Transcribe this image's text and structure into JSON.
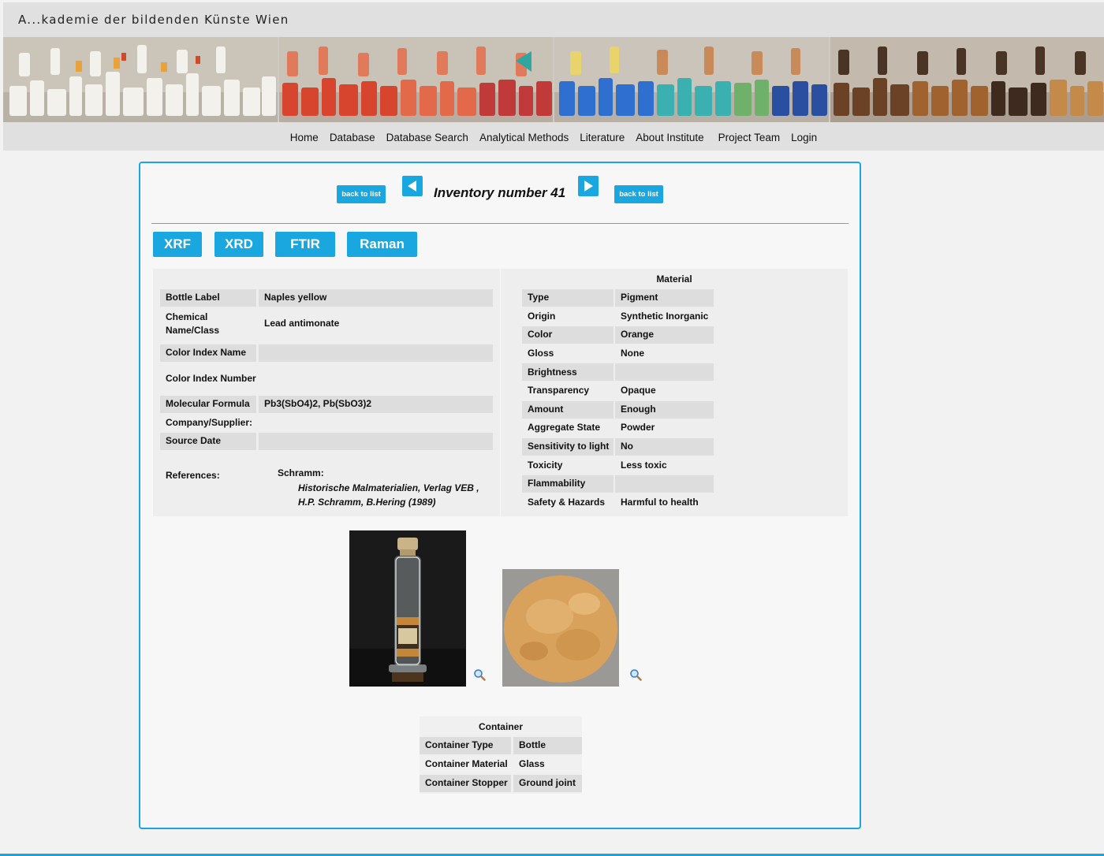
{
  "header": {
    "site_title": "A...kademie der bildenden Künste Wien"
  },
  "nav": {
    "items": [
      "Home",
      "Database",
      "Database Search",
      "Analytical Methods",
      "Literature",
      "About Institute",
      "Project Team",
      "Login"
    ]
  },
  "record": {
    "back_label_left": "back to list",
    "back_label_right": "back to list",
    "title": "Inventory number 41",
    "prev_icon": "triangle-left-icon",
    "next_icon": "triangle-right-icon"
  },
  "tabs": [
    "XRF",
    "XRD",
    "FTIR",
    "Raman"
  ],
  "general": {
    "rows": [
      {
        "label": "Bottle Label",
        "value": "Naples yellow"
      },
      {
        "label": "Chemical Name/Class",
        "value": "Lead antimonate"
      },
      {
        "label": "Color Index Name",
        "value": ""
      },
      {
        "label": "Color Index Number",
        "value": ""
      },
      {
        "label": "Molecular Formula",
        "value": "Pb3(SbO4)2, Pb(SbO3)2"
      },
      {
        "label": "Company/Supplier:",
        "value": ""
      },
      {
        "label": "Source Date",
        "value": ""
      }
    ],
    "references_label": "References:",
    "references_author": "Schramm:",
    "references_line1": "Historische Malmaterialien, Verlag VEB ,",
    "references_line2": "H.P. Schramm, B.Hering (1989)"
  },
  "material": {
    "heading": "Material",
    "rows": [
      {
        "label": "Type",
        "value": "Pigment"
      },
      {
        "label": "Origin",
        "value": "Synthetic Inorganic"
      },
      {
        "label": "Color",
        "value": "Orange"
      },
      {
        "label": "Gloss",
        "value": "None"
      },
      {
        "label": "Brightness",
        "value": ""
      },
      {
        "label": "Transparency",
        "value": "Opaque"
      },
      {
        "label": "Amount",
        "value": "Enough"
      },
      {
        "label": "Aggregate State",
        "value": "Powder"
      },
      {
        "label": "Sensitivity to light",
        "value": "No"
      },
      {
        "label": "Toxicity",
        "value": "Less toxic"
      },
      {
        "label": "Flammability",
        "value": ""
      },
      {
        "label": "Safety & Hazards",
        "value": "Harmful to health"
      }
    ]
  },
  "images": {
    "zoom_icon": "magnifier-icon"
  },
  "container": {
    "heading": "Container",
    "rows": [
      {
        "label": "Container Type",
        "value": "Bottle"
      },
      {
        "label": "Container Material",
        "value": "Glass"
      },
      {
        "label": "Container Stopper",
        "value": "Ground joint"
      }
    ]
  },
  "colors": {
    "accent": "#1aa7e0",
    "header_bg": "#e0e0e0",
    "row_shade": "#dddddd",
    "pigment": "#d9a25c"
  }
}
